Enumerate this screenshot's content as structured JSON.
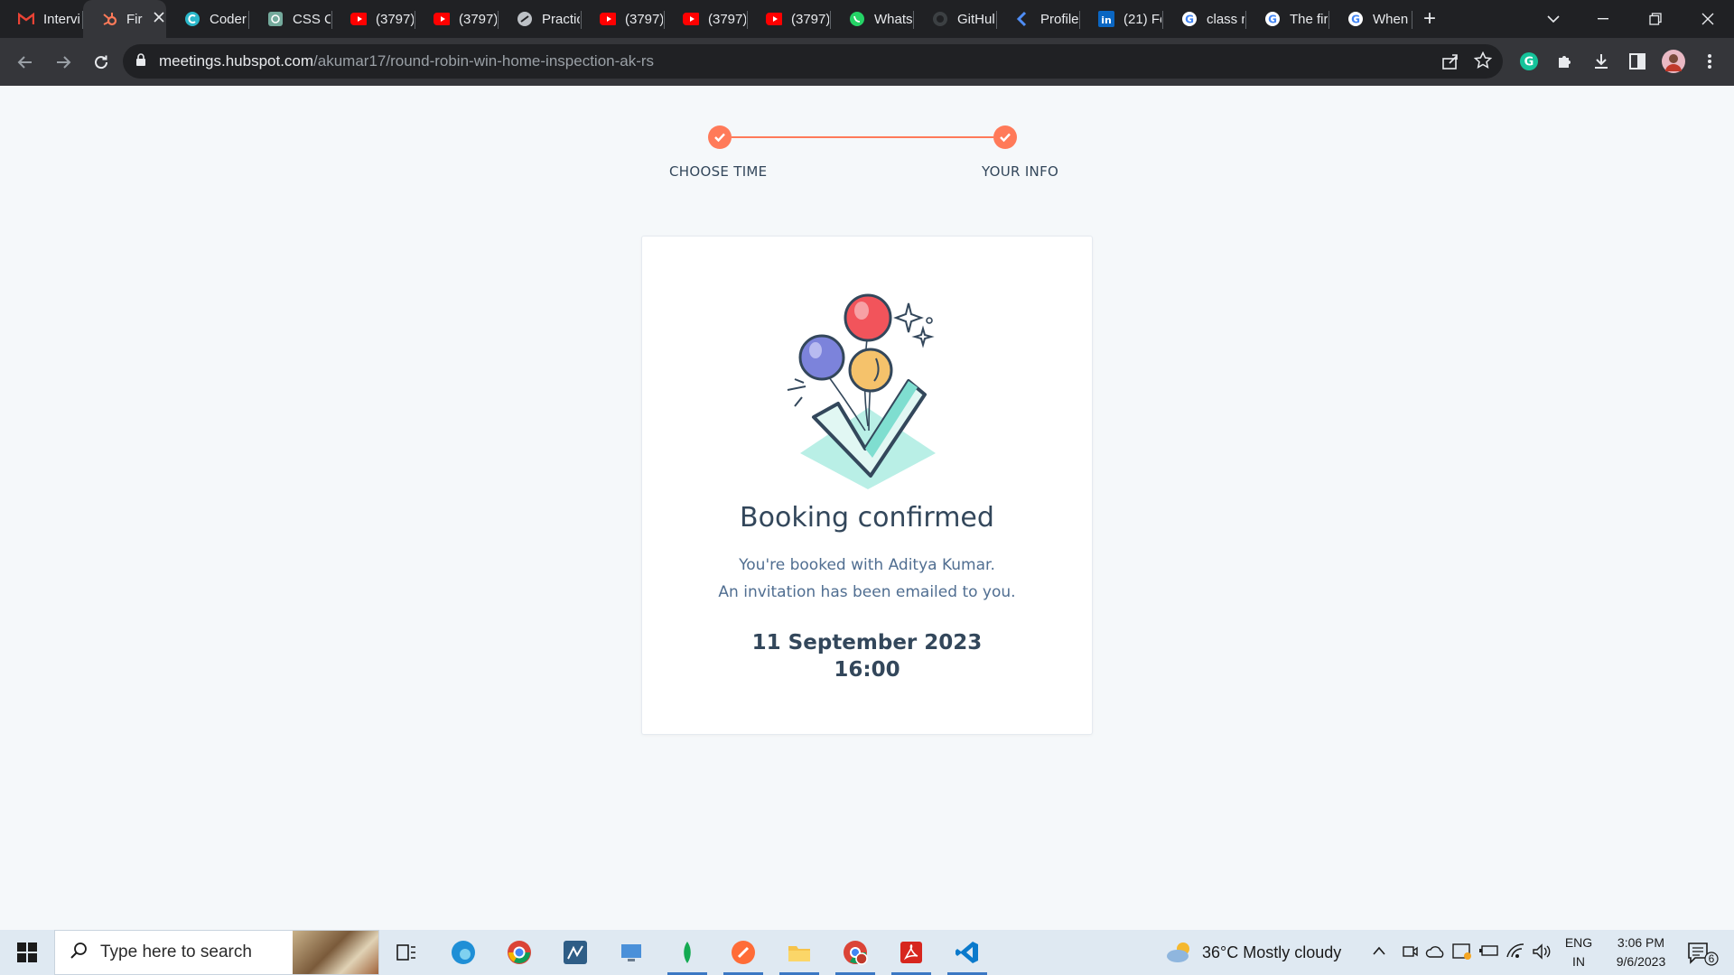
{
  "browser": {
    "tabs": [
      {
        "title": "Intervi",
        "icon": "gmail-icon"
      },
      {
        "title": "Fir",
        "icon": "hubspot-icon",
        "active": true
      },
      {
        "title": "Coder",
        "icon": "coder-icon"
      },
      {
        "title": "CSS C",
        "icon": "chatgpt-icon"
      },
      {
        "title": "(3797)",
        "icon": "youtube-icon"
      },
      {
        "title": "(3797)",
        "icon": "youtube-icon"
      },
      {
        "title": "Practic",
        "icon": "practice-icon"
      },
      {
        "title": "(3797)",
        "icon": "youtube-icon"
      },
      {
        "title": "(3797)",
        "icon": "youtube-icon"
      },
      {
        "title": "(3797)",
        "icon": "youtube-icon"
      },
      {
        "title": "Whats",
        "icon": "whatsapp-icon"
      },
      {
        "title": "GitHul",
        "icon": "github-icon"
      },
      {
        "title": "Profile",
        "icon": "profile-icon"
      },
      {
        "title": "(21) Fe",
        "icon": "linkedin-icon"
      },
      {
        "title": "class r",
        "icon": "google-icon"
      },
      {
        "title": "The fir",
        "icon": "google-icon"
      },
      {
        "title": "When",
        "icon": "google-icon"
      }
    ],
    "new_tab_glyph": "+",
    "url_host": "meetings.hubspot.com",
    "url_path": "/akumar17/round-robin-win-home-inspection-ak-rs"
  },
  "steps": {
    "step1": "CHOOSE TIME",
    "step2": "YOUR INFO"
  },
  "confirmation": {
    "title": "Booking confirmed",
    "line1": "You're booked with Aditya Kumar.",
    "line2": "An invitation has been emailed to you.",
    "date": "11 September 2023",
    "time": "16:00"
  },
  "taskbar": {
    "search_placeholder": "Type here to search",
    "weather": "36°C  Mostly cloudy",
    "lang_top": "ENG",
    "lang_bottom": "IN",
    "clock_time": "3:06 PM",
    "clock_date": "9/6/2023",
    "notification_count": "6"
  },
  "colors": {
    "accent": "#ff7a59",
    "text_dark": "#33475b",
    "page_bg": "#f5f8fa"
  }
}
